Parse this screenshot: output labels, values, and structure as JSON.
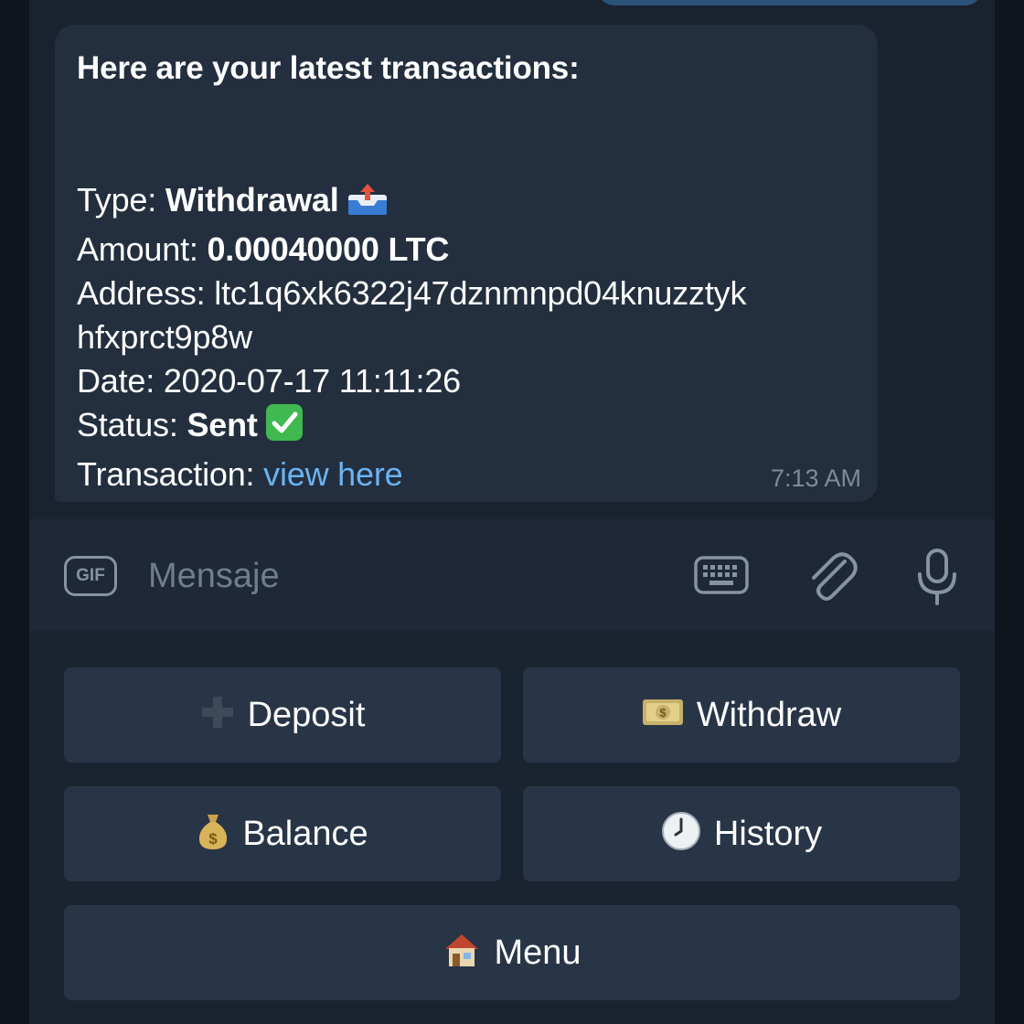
{
  "message": {
    "title": "Here are your latest transactions:",
    "type_label": "Type: ",
    "type_value": "Withdrawal",
    "amount_label": "Amount: ",
    "amount_value": "0.00040000 LTC",
    "address_label": "Address: ",
    "address_line1": "ltc1q6xk6322j47dznmnpd04knuzztyk",
    "address_line2": "hfxprct9p8w",
    "date_label": "Date: ",
    "date_value": "2020-07-17 11:11:26",
    "status_label": "Status: ",
    "status_value": "Sent",
    "transaction_label": "Transaction: ",
    "transaction_link": "view here",
    "time": "7:13 AM"
  },
  "input": {
    "gif_label": "GIF",
    "placeholder": "Mensaje"
  },
  "keyboard": {
    "deposit": "Deposit",
    "withdraw": "Withdraw",
    "balance": "Balance",
    "history": "History",
    "menu": "Menu"
  },
  "icons": {
    "type_emoji": "outbox-tray-icon",
    "status_emoji": "check-mark-button-icon",
    "deposit": "heavy-plus-icon",
    "withdraw": "dollar-banknote-icon",
    "balance": "money-bag-icon",
    "history": "clock-icon",
    "menu": "house-icon"
  },
  "colors": {
    "link": "#6ab3f3",
    "bubble": "#232f3e",
    "button": "#283547"
  }
}
